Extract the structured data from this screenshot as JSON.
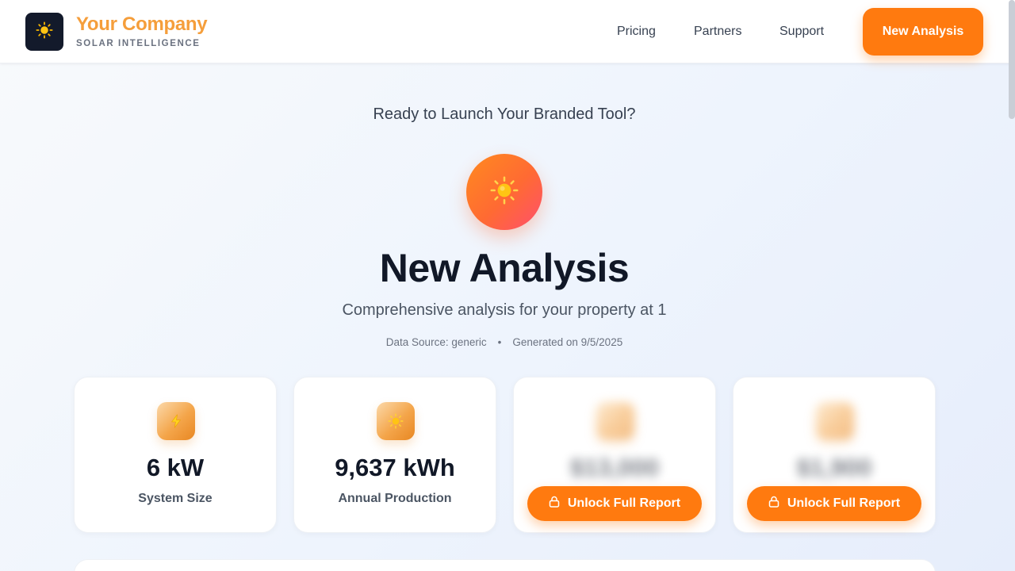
{
  "header": {
    "brand_name": "Your Company",
    "brand_tagline": "SOLAR INTELLIGENCE",
    "logo_icon": "sun-icon",
    "nav": [
      {
        "label": "Pricing"
      },
      {
        "label": "Partners"
      },
      {
        "label": "Support"
      }
    ],
    "cta_label": "New Analysis"
  },
  "hero": {
    "prompt": "Ready to Launch Your Branded Tool?",
    "icon": "sun-icon",
    "title": "New Analysis",
    "subtitle": "Comprehensive analysis for your property at 1",
    "data_source": "Data Source: generic",
    "separator": "•",
    "generated": "Generated on 9/5/2025"
  },
  "cards": [
    {
      "icon": "lightning-icon",
      "value": "6 kW",
      "label": "System Size",
      "locked": false
    },
    {
      "icon": "sun-icon",
      "value": "9,637 kWh",
      "label": "Annual Production",
      "locked": false
    },
    {
      "icon": "sun-icon",
      "value": "$13,000",
      "locked": true,
      "unlock_label": "Unlock Full Report"
    },
    {
      "icon": "sun-icon",
      "value": "$1,900",
      "locked": true,
      "unlock_label": "Unlock Full Report"
    }
  ],
  "colors": {
    "accent": "#ff7a0f",
    "brand": "#f59e3b",
    "hero_gradient_start": "#ff8a1f",
    "hero_gradient_end": "#ff4f6e",
    "text_dark": "#111827"
  }
}
